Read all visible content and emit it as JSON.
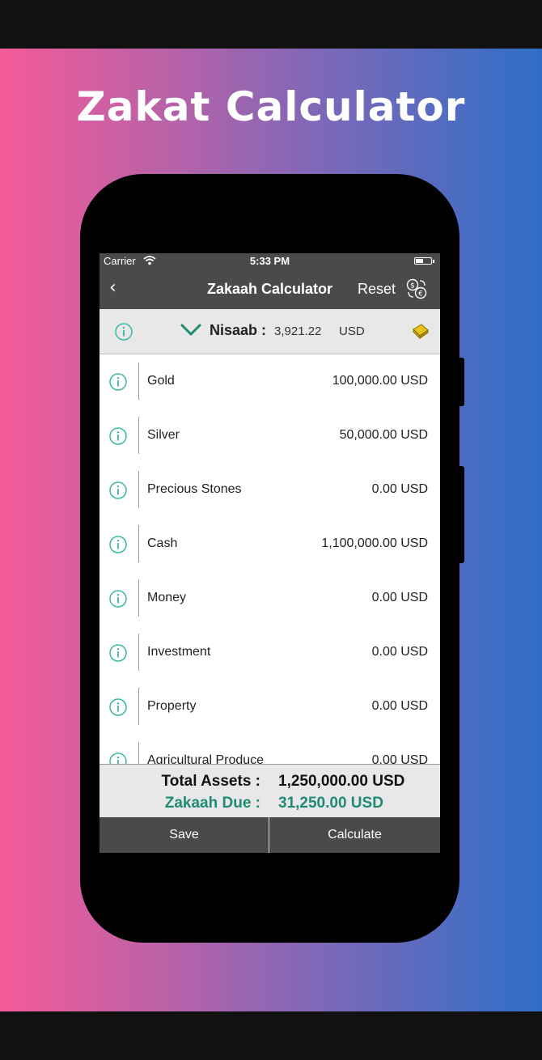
{
  "promo": {
    "title": "Zakat Calculator"
  },
  "status_bar": {
    "carrier": "Carrier",
    "time": "5:33 PM"
  },
  "nav": {
    "back_icon": "‹",
    "title": "Zakaah Calculator",
    "reset_label": "Reset",
    "currency_icon": "currency-exchange-icon"
  },
  "nisaab": {
    "label": "Nisaab :",
    "value": "3,921.22",
    "unit": "USD",
    "icon": "gold-bar-icon"
  },
  "assets": [
    {
      "label": "Gold",
      "value": "100,000.00 USD"
    },
    {
      "label": "Silver",
      "value": "50,000.00 USD"
    },
    {
      "label": "Precious Stones",
      "value": "0.00 USD"
    },
    {
      "label": "Cash",
      "value": "1,100,000.00 USD"
    },
    {
      "label": "Money",
      "value": "0.00 USD"
    },
    {
      "label": "Investment",
      "value": "0.00 USD"
    },
    {
      "label": "Property",
      "value": "0.00 USD"
    },
    {
      "label": "Agricultural Produce",
      "value": "0.00 USD"
    }
  ],
  "totals": {
    "total_label": "Total Assets :",
    "total_value": "1,250,000.00 USD",
    "due_label": "Zakaah Due :",
    "due_value": "31,250.00 USD"
  },
  "actions": {
    "save_label": "Save",
    "calculate_label": "Calculate"
  },
  "colors": {
    "accent_teal": "#1f8b72",
    "info_icon": "#3bb8a6",
    "bar_gray": "#4a4a4a"
  }
}
